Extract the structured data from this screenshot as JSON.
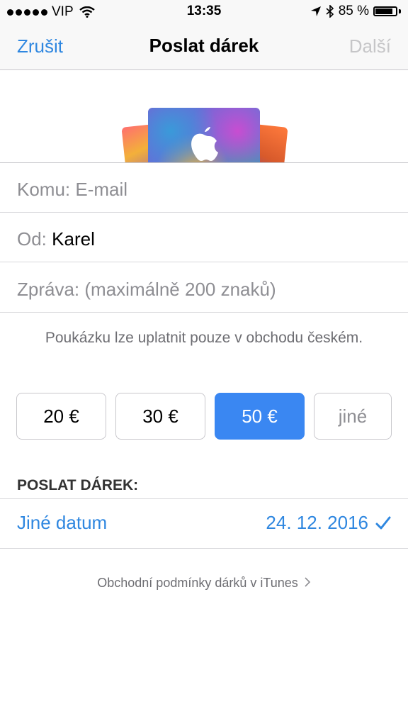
{
  "status": {
    "carrier": "VIP",
    "time": "13:35",
    "battery": "85 %",
    "battery_level": 0.85
  },
  "nav": {
    "cancel": "Zrušit",
    "title": "Poslat dárek",
    "next": "Další"
  },
  "form": {
    "to_label": "Komu:",
    "to_placeholder": "E-mail",
    "from_label": "Od:",
    "from_value": "Karel",
    "message_label": "Zpráva:",
    "message_placeholder": "(maximálně 200 znaků)"
  },
  "note": "Poukázku lze uplatnit pouze v obchodu českém.",
  "amounts": [
    {
      "label": "20 €",
      "selected": false
    },
    {
      "label": "30 €",
      "selected": false
    },
    {
      "label": "50 €",
      "selected": true
    },
    {
      "label": "jiné",
      "selected": false
    }
  ],
  "send": {
    "header": "POSLAT DÁREK:",
    "option": "Jiné datum",
    "date": "24. 12. 2016"
  },
  "terms": "Obchodní podmínky dárků v iTunes",
  "colors": {
    "accent": "#2f87e0",
    "selected_button": "#3a87f2"
  },
  "icons": {
    "signal": "signal-dots-icon",
    "wifi": "wifi-icon",
    "location": "location-arrow-icon",
    "bluetooth": "bluetooth-icon",
    "battery": "battery-icon",
    "check": "checkmark-icon",
    "chevron": "chevron-right-icon",
    "apple": "apple-logo-icon"
  }
}
